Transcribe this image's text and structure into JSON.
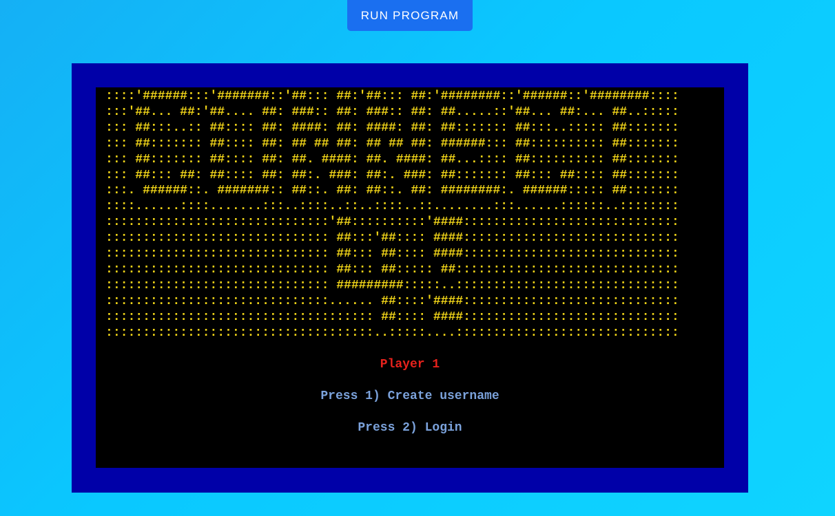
{
  "toolbar": {
    "run_label": "RUN PROGRAM"
  },
  "terminal": {
    "ascii_art": "::::'######:::'#######::'##::: ##:'##::: ##:'########::'######::'########::::\n:::'##... ##:'##.... ##: ###:: ##: ###:: ##: ##.....::'##... ##:... ##..:::::\n::: ##:::..:: ##:::: ##: ####: ##: ####: ##: ##::::::: ##:::..::::: ##:::::::\n::: ##::::::: ##:::: ##: ## ## ##: ## ## ##: ######::: ##:::::::::: ##:::::::\n::: ##::::::: ##:::: ##: ##. ####: ##. ####: ##...:::: ##:::::::::: ##:::::::\n::: ##::: ##: ##:::: ##: ##:. ###: ##:. ###: ##::::::: ##::: ##:::: ##:::::::\n:::. ######::. #######:: ##::. ##: ##::. ##: ########:. ######::::: ##:::::::\n::::......::::.......:::..::::..::..::::..::........:::......::::::..::::::::\n::::::::::::::::::::::::::::::'##::::::::::'####:::::::::::::::::::::::::::::\n:::::::::::::::::::::::::::::: ##:::'##:::: ####:::::::::::::::::::::::::::::\n:::::::::::::::::::::::::::::: ##::: ##:::: ####:::::::::::::::::::::::::::::\n:::::::::::::::::::::::::::::: ##::: ##::::: ##::::::::::::::::::::::::::::::\n:::::::::::::::::::::::::::::: #########:::::..::::::::::::::::::::::::::::::\n::::::::::::::::::::::::::::::...... ##::::'####:::::::::::::::::::::::::::::\n:::::::::::::::::::::::::::::::::::: ##:::: ####:::::::::::::::::::::::::::::\n::::::::::::::::::::::::::::::::::::..:::::....::::::::::::::::::::::::::::::",
    "player_label": "Player 1",
    "option_1": "Press 1) Create username",
    "option_2": "Press 2) Login"
  },
  "colors": {
    "background_accent": "#0ac8ff",
    "run_button": "#1a6ff0",
    "terminal_frame": "#0000a8",
    "terminal_bg": "#000000",
    "ascii_art": "#f0d418",
    "player_label": "#e8221c",
    "menu_text": "#7ba2db"
  }
}
